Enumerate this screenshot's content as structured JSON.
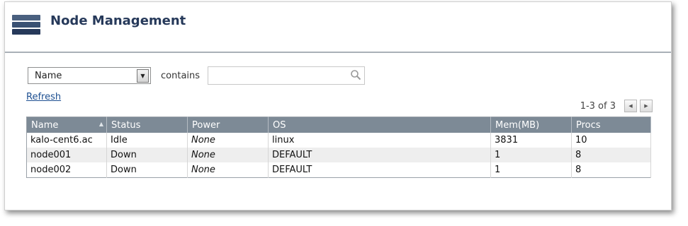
{
  "header": {
    "title": "Node Management",
    "logo_icon": "server-stack-icon"
  },
  "filter": {
    "field_select": {
      "value": "Name",
      "arrow_icon": "dropdown-arrow-icon"
    },
    "operator_label": "contains",
    "search": {
      "value": "",
      "placeholder": "",
      "icon": "magnifier-icon"
    }
  },
  "refresh_label": "Refresh",
  "pager": {
    "range": "1-3 of 3",
    "prev_icon": "prev-page-icon",
    "next_icon": "next-page-icon"
  },
  "table": {
    "columns": [
      "Name",
      "Status",
      "Power",
      "OS",
      "Mem(MB)",
      "Procs"
    ],
    "sorted_column": "Name",
    "rows": [
      {
        "name": "kalo-cent6.ac",
        "status": "Idle",
        "power": "None",
        "os": "linux",
        "mem": "3831",
        "procs": "10"
      },
      {
        "name": "node001",
        "status": "Down",
        "power": "None",
        "os": "DEFAULT",
        "mem": "1",
        "procs": "8"
      },
      {
        "name": "node002",
        "status": "Down",
        "power": "None",
        "os": "DEFAULT",
        "mem": "1",
        "procs": "8"
      }
    ]
  },
  "colors": {
    "title": "#26395a",
    "header_bg": "#7d8a96",
    "link": "#1d4f91",
    "alt_row": "#eeeeee"
  }
}
